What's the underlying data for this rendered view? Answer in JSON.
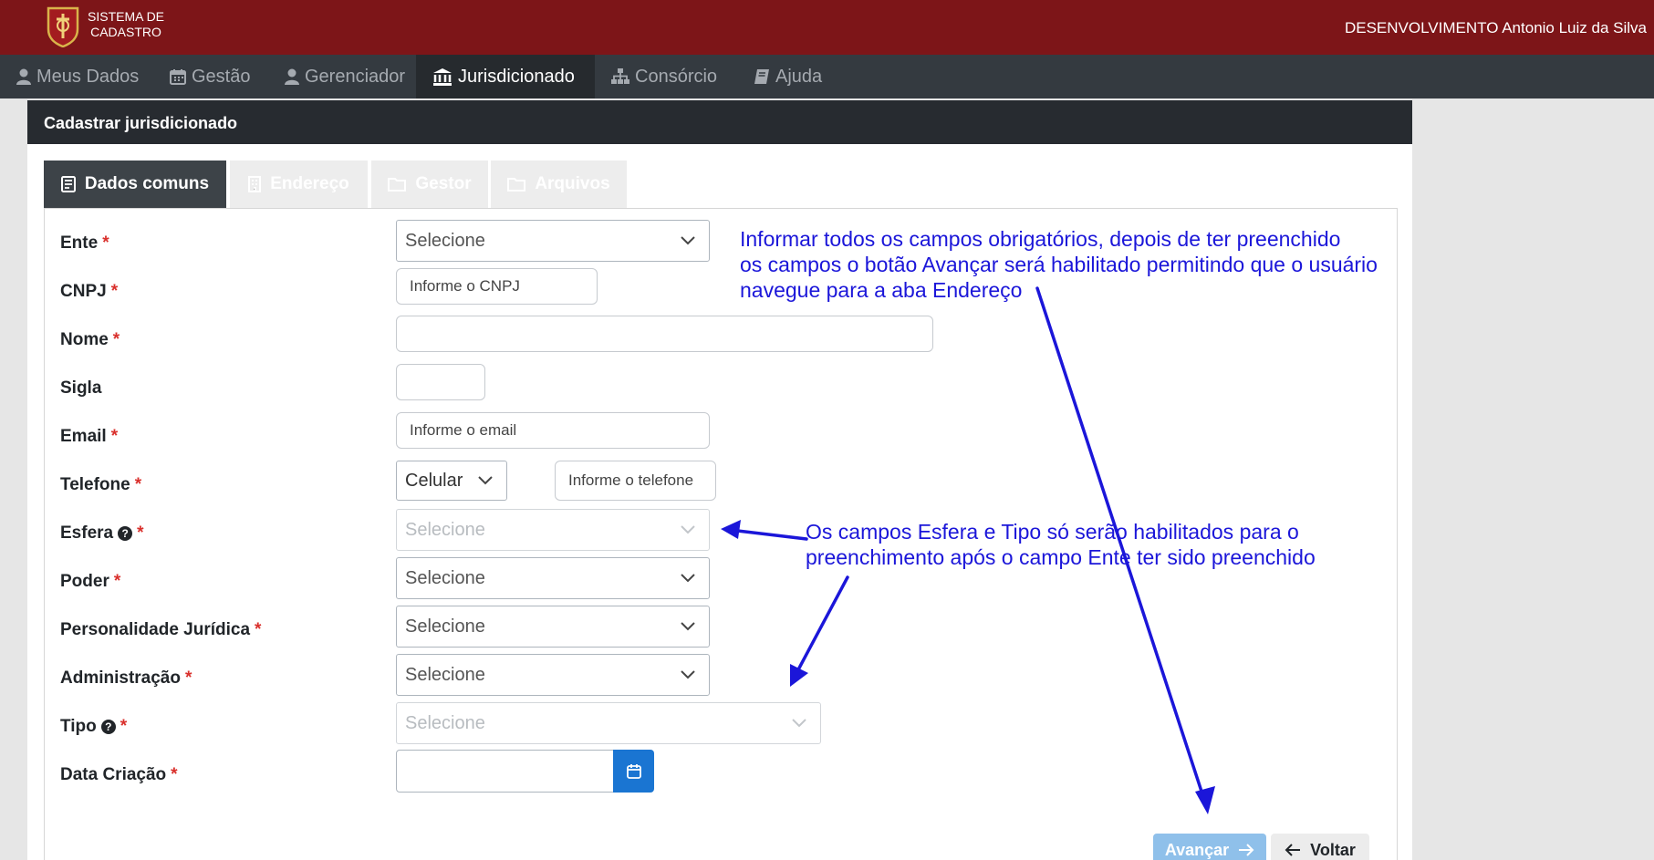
{
  "header": {
    "brand_line1": "SISTEMA DE",
    "brand_line2": "CADASTRO",
    "user": "DESENVOLVIMENTO Antonio Luiz da Silva"
  },
  "nav": {
    "meus_dados": "Meus Dados",
    "gestao": "Gestão",
    "gerenciador": "Gerenciador",
    "jurisdicionado": "Jurisdicionado",
    "consorcio": "Consórcio",
    "ajuda": "Ajuda"
  },
  "card": {
    "title": "Cadastrar jurisdicionado"
  },
  "tabs": {
    "dados_comuns": "Dados comuns",
    "endereco": "Endereço",
    "gestor": "Gestor",
    "arquivos": "Arquivos"
  },
  "form": {
    "required_mark": "*",
    "help_mark": "?",
    "ente": {
      "label": "Ente",
      "value": "Selecione"
    },
    "cnpj": {
      "label": "CNPJ",
      "placeholder": "Informe o CNPJ"
    },
    "nome": {
      "label": "Nome"
    },
    "sigla": {
      "label": "Sigla"
    },
    "email": {
      "label": "Email",
      "placeholder": "Informe o email"
    },
    "telefone": {
      "label": "Telefone",
      "type_value": "Celular",
      "placeholder": "Informe o telefone"
    },
    "esfera": {
      "label": "Esfera",
      "value": "Selecione"
    },
    "poder": {
      "label": "Poder",
      "value": "Selecione"
    },
    "personalidade": {
      "label": "Personalidade Jurídica",
      "value": "Selecione"
    },
    "administracao": {
      "label": "Administração",
      "value": "Selecione"
    },
    "tipo": {
      "label": "Tipo",
      "value": "Selecione"
    },
    "data_criacao": {
      "label": "Data Criação"
    }
  },
  "buttons": {
    "avancar": "Avançar",
    "voltar": "Voltar"
  },
  "notes": {
    "note1_line1": "Informar todos os campos obrigatórios, depois de ter preenchido",
    "note1_line2": "os campos o botão Avançar será habilitado permitindo que o usuário",
    "note1_line3": "navegue para a aba Endereço",
    "note2_line1": "Os campos Esfera e Tipo só serão habilitados para o",
    "note2_line2": "preenchimento após o campo Ente ter sido preenchido"
  },
  "colors": {
    "topbar": "#7d1518",
    "navbar": "#343a40",
    "annotation": "#1b16d9",
    "primary": "#1a75d2",
    "required": "#d9302c"
  },
  "icons": [
    "user-icon",
    "calendar-icon",
    "bank-icon",
    "sitemap-icon",
    "book-icon",
    "document-icon",
    "building-icon",
    "folder-icon",
    "chevron-down-icon",
    "arrow-right-icon",
    "arrow-left-icon",
    "help-icon"
  ]
}
